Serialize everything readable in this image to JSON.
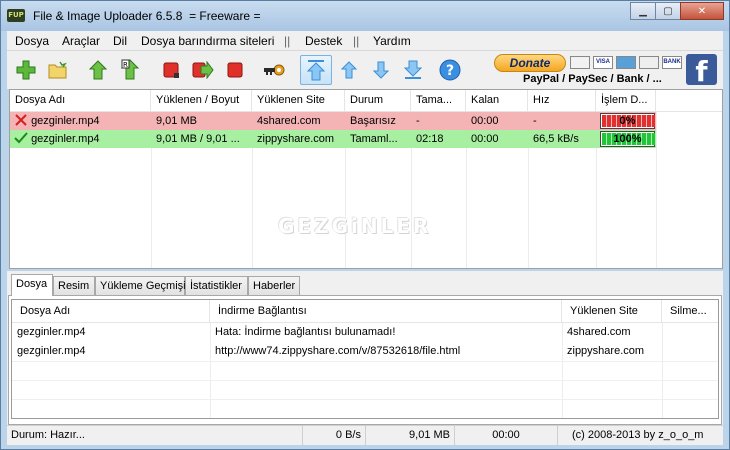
{
  "window": {
    "app_icon_text": "FUP",
    "title": "File & Image Uploader 6.5.8  = Freeware ="
  },
  "menu": [
    "Dosya",
    "Araçlar",
    "Dil",
    "Dosya barındırma siteleri",
    "||",
    "Destek",
    "||",
    "Yardım"
  ],
  "toolbar": {
    "donate_label": "Donate",
    "cards": [
      "",
      "VISA",
      "",
      "",
      "BANK"
    ],
    "payment_text": "PayPal / PaySec / Bank / ...",
    "facebook_glyph": "f",
    "icons": [
      "add-icon",
      "folder-icon",
      "upload-up-icon",
      "upload-cloud-icon",
      "stop-icon",
      "forward-icon",
      "stop-all-icon",
      "key-icon",
      "move-top-icon",
      "move-up-icon",
      "move-down-icon",
      "move-bottom-icon",
      "help-icon"
    ]
  },
  "upload_table": {
    "columns": [
      "Dosya Adı",
      "Yüklenen / Boyut",
      "Yüklenen Site",
      "Durum",
      "Tama...",
      "Kalan",
      "Hız",
      "İşlem D..."
    ],
    "rows": [
      {
        "status": "fail",
        "name": "gezginler.mp4",
        "uploaded": "9,01 MB",
        "site": "4shared.com",
        "state": "Başarısız",
        "elapsed": "-",
        "remaining": "00:00",
        "speed": "-",
        "progress_text": "0%",
        "progress": 0
      },
      {
        "status": "ok",
        "name": "gezginler.mp4",
        "uploaded": "9,01 MB / 9,01 ...",
        "site": "zippyshare.com",
        "state": "Tamaml...",
        "elapsed": "02:18",
        "remaining": "00:00",
        "speed": "66,5 kB/s",
        "progress_text": "100%",
        "progress": 100
      }
    ],
    "watermark": "GEZGiNLER"
  },
  "tabs": [
    "Dosya",
    "Resim",
    "Yükleme Geçmişi",
    "İstatistikler",
    "Haberler"
  ],
  "detail_table": {
    "columns": [
      "Dosya Adı",
      "İndirme Bağlantısı",
      "Yüklenen Site",
      "Silme..."
    ],
    "rows": [
      {
        "name": "gezginler.mp4",
        "link": "Hata: İndirme bağlantısı bulunamadı!",
        "site": "4shared.com",
        "delete": ""
      },
      {
        "name": "gezginler.mp4",
        "link": "http://www74.zippyshare.com/v/87532618/file.html",
        "site": "zippyshare.com",
        "delete": ""
      }
    ]
  },
  "statusbar": {
    "status": "Durum: Hazır...",
    "speed": "0 B/s",
    "size": "9,01 MB",
    "time": "00:00",
    "copyright": "(c) 2008-2013 by z_o_o_m"
  },
  "colors": {
    "fail_row": "#f4b3b4",
    "ok_row": "#a8f0a1",
    "progress_red": "#e03030",
    "progress_green": "#22c43a"
  }
}
